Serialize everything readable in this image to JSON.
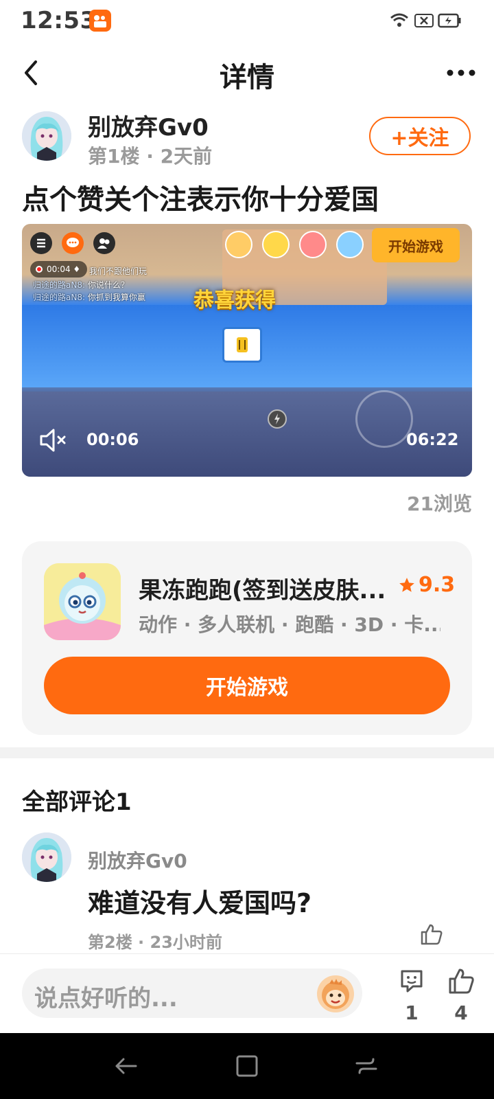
{
  "status_bar": {
    "time": "12:53"
  },
  "header": {
    "title": "详情"
  },
  "post": {
    "author": "别放弃Gv0",
    "meta": "第1楼 · 2天前",
    "follow_label": "+关注",
    "text": "点个赞关个注表示你十分爱国",
    "views": "21浏览"
  },
  "video": {
    "rec_time": "00:04",
    "chat": [
      {
        "who": "",
        "msg": "我们不跟他们玩"
      },
      {
        "who": "归途的路aN8:",
        "msg": " 你说什么？"
      },
      {
        "who": "归途的路aN8:",
        "msg": " 你抓到我算你赢"
      }
    ],
    "banner": "恭喜获得",
    "start_label": "开始游戏",
    "current_time": "00:06",
    "duration": "06:22"
  },
  "game": {
    "name": "果冻跑跑(签到送皮肤...",
    "rating": "9.3",
    "tags": "动作 · 多人联机 · 跑酷 · 3D · 卡...",
    "play_label": "开始游戏"
  },
  "comments": {
    "title": "全部评论1",
    "items": [
      {
        "author": "别放弃Gv0",
        "text": "难道没有人爱国吗?",
        "meta": "第2楼 · 23小时前"
      }
    ]
  },
  "bottom_bar": {
    "placeholder": "说点好听的...",
    "comment_count": "1",
    "like_count": "4"
  },
  "colors": {
    "accent": "#ff6a10"
  }
}
